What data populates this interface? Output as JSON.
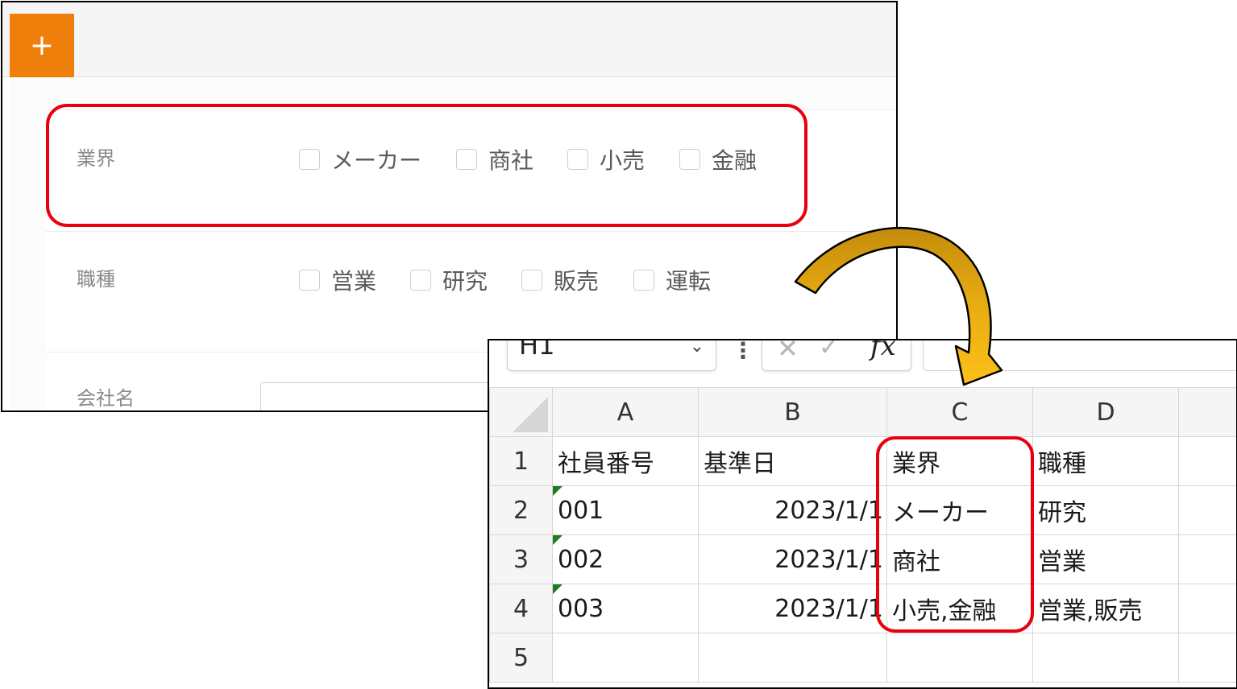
{
  "colors": {
    "accent_orange": "#ee7f0a",
    "highlight_red": "#e8000d",
    "arrow_gold": "#f2b80f",
    "text_number_flag": "#1e7b1e"
  },
  "form": {
    "add_button_label": "+",
    "industry": {
      "label": "業界",
      "options": [
        "メーカー",
        "商社",
        "小売",
        "金融"
      ]
    },
    "job_type": {
      "label": "職種",
      "options": [
        "営業",
        "研究",
        "販売",
        "運転"
      ]
    },
    "company_name": {
      "label": "会社名",
      "value": ""
    }
  },
  "spreadsheet": {
    "name_box": "H1",
    "formula_cancel_icon": "cancel-x-icon",
    "formula_confirm_icon": "confirm-check-icon",
    "fx_label": "fx",
    "formula_value": "",
    "columns": [
      "A",
      "B",
      "C",
      "D"
    ],
    "rows": [
      {
        "num": "1",
        "cells": [
          "社員番号",
          "基準日",
          "業界",
          "職種"
        ]
      },
      {
        "num": "2",
        "cells": [
          "001",
          "2023/1/1",
          "メーカー",
          "研究"
        ]
      },
      {
        "num": "3",
        "cells": [
          "002",
          "2023/1/1",
          "商社",
          "営業"
        ]
      },
      {
        "num": "4",
        "cells": [
          "003",
          "2023/1/1",
          "小売,金融",
          "営業,販売"
        ]
      },
      {
        "num": "5",
        "cells": [
          "",
          "",
          "",
          ""
        ]
      }
    ]
  }
}
